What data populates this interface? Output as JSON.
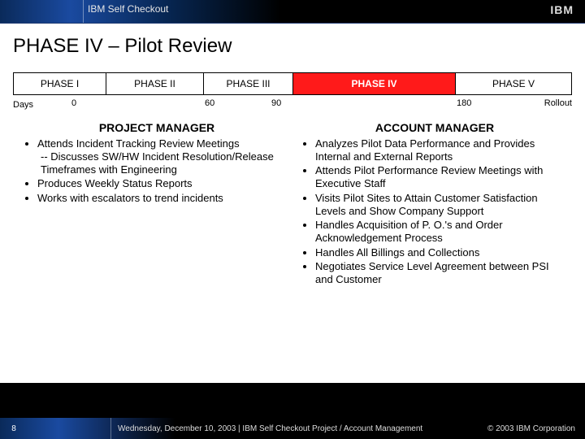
{
  "header": {
    "subtitle": "IBM Self Checkout",
    "logo": "IBM"
  },
  "title": "PHASE IV – Pilot Review",
  "phases": {
    "p1": "PHASE I",
    "p2": "PHASE II",
    "p3": "PHASE III",
    "p4": "PHASE IV",
    "p5": "PHASE V"
  },
  "days": {
    "label": "Days",
    "t0": "0",
    "t60": "60",
    "t90": "90",
    "t180": "180",
    "rollout": "Rollout"
  },
  "left": {
    "heading": "PROJECT MANAGER",
    "b1": "Attends Incident Tracking Review Meetings",
    "b1sub": "-- Discusses SW/HW  Incident Resolution/Release Timeframes with Engineering",
    "b2": "Produces Weekly Status Reports",
    "b3": "Works with escalators to trend incidents"
  },
  "right": {
    "heading": "ACCOUNT MANAGER",
    "b1": "Analyzes Pilot Data Performance and Provides Internal and External Reports",
    "b2": "Attends Pilot Performance Review Meetings with Executive Staff",
    "b3": "Visits Pilot Sites to Attain Customer Satisfaction Levels and Show Company Support",
    "b4": "Handles Acquisition of P. O.'s and Order Acknowledgement Process",
    "b5": "Handles All Billings and Collections",
    "b6": "Negotiates Service Level Agreement between PSI and Customer"
  },
  "footer": {
    "page": "8",
    "text": "Wednesday, December 10, 2003  |  IBM Self Checkout Project / Account Management",
    "copy": "© 2003 IBM Corporation"
  }
}
